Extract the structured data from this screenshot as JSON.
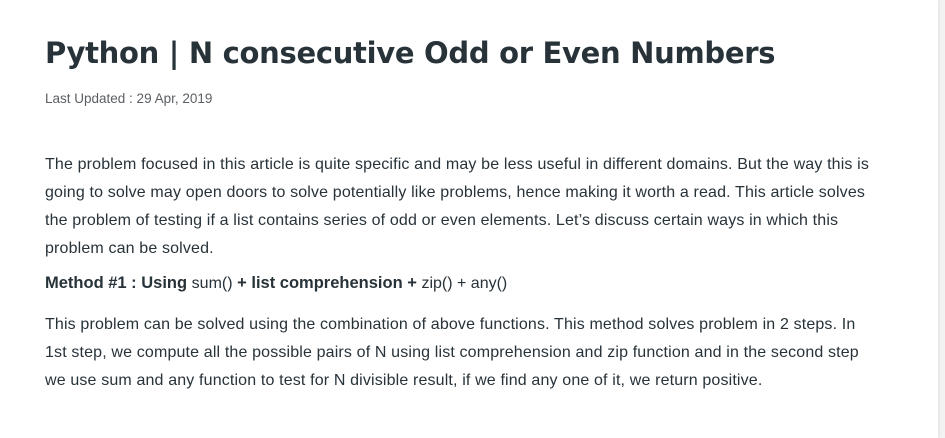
{
  "article": {
    "title": "Python | N consecutive Odd or Even Numbers",
    "last_updated": "Last Updated : 29 Apr, 2019",
    "intro": "The problem focused in this article is quite specific and may be less useful in different domains. But the way this is going to solve may open doors to solve potentially like problems, hence making it worth a read. This article solves the problem of testing if a list contains series of odd or even elements. Let’s discuss certain ways in which this problem can be solved.",
    "method1": {
      "prefix": "Method #1 : Using ",
      "code1": "sum()",
      "mid": " + list comprehension + ",
      "code2": "zip()",
      "plus": " + ",
      "code3": "any()"
    },
    "method1_description": "This problem can be solved using the combination of above functions. This method solves problem in 2 steps. In 1st step, we compute all the possible pairs of N using list comprehension and zip function and in the second step we use sum and any function to test for N divisible result, if we find any one of it, we return positive."
  }
}
